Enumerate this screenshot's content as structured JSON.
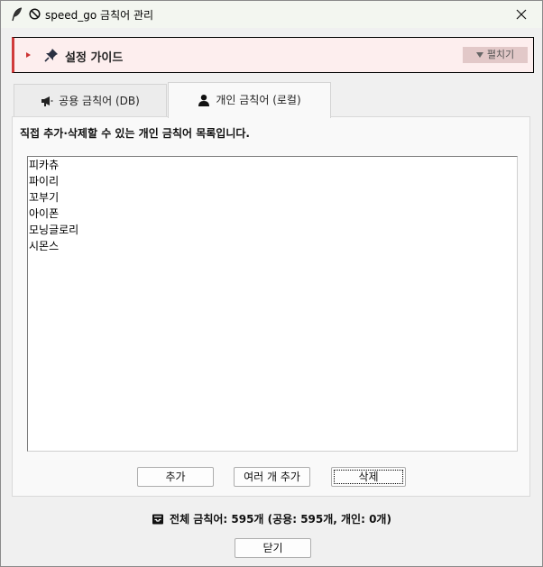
{
  "window": {
    "title": "speed_go 금칙어 관리"
  },
  "guide": {
    "title": "설정 가이드",
    "toggle_label": "펼치기"
  },
  "tabs": [
    {
      "label": "공용 금칙어 (DB)"
    },
    {
      "label": "개인 금칙어 (로컬)"
    }
  ],
  "panel": {
    "description": "직접 추가·삭제할 수 있는 개인 금칙어 목록입니다.",
    "words": [
      "피카츄",
      "파이리",
      "꼬부기",
      "아이폰",
      "모닝글로리",
      "시몬스"
    ],
    "buttons": {
      "add": "추가",
      "add_multiple": "여러 개 추가",
      "delete": "삭제"
    }
  },
  "footer": {
    "summary": "전체 금칙어: 595개 (공용: 595개, 개인: 0개)",
    "close_label": "닫기"
  },
  "colors": {
    "guide_accent": "#d03a3a",
    "guide_background": "#fdeeee"
  },
  "icons": {
    "title": [
      "feather-icon",
      "prohibited-icon"
    ],
    "guide": [
      "caret-right-icon",
      "pushpin-icon"
    ],
    "toggle": "caret-down-icon",
    "tab_public": "megaphone-icon",
    "tab_private": "user-icon",
    "summary": "inbox-icon",
    "window_close": "close-icon"
  }
}
